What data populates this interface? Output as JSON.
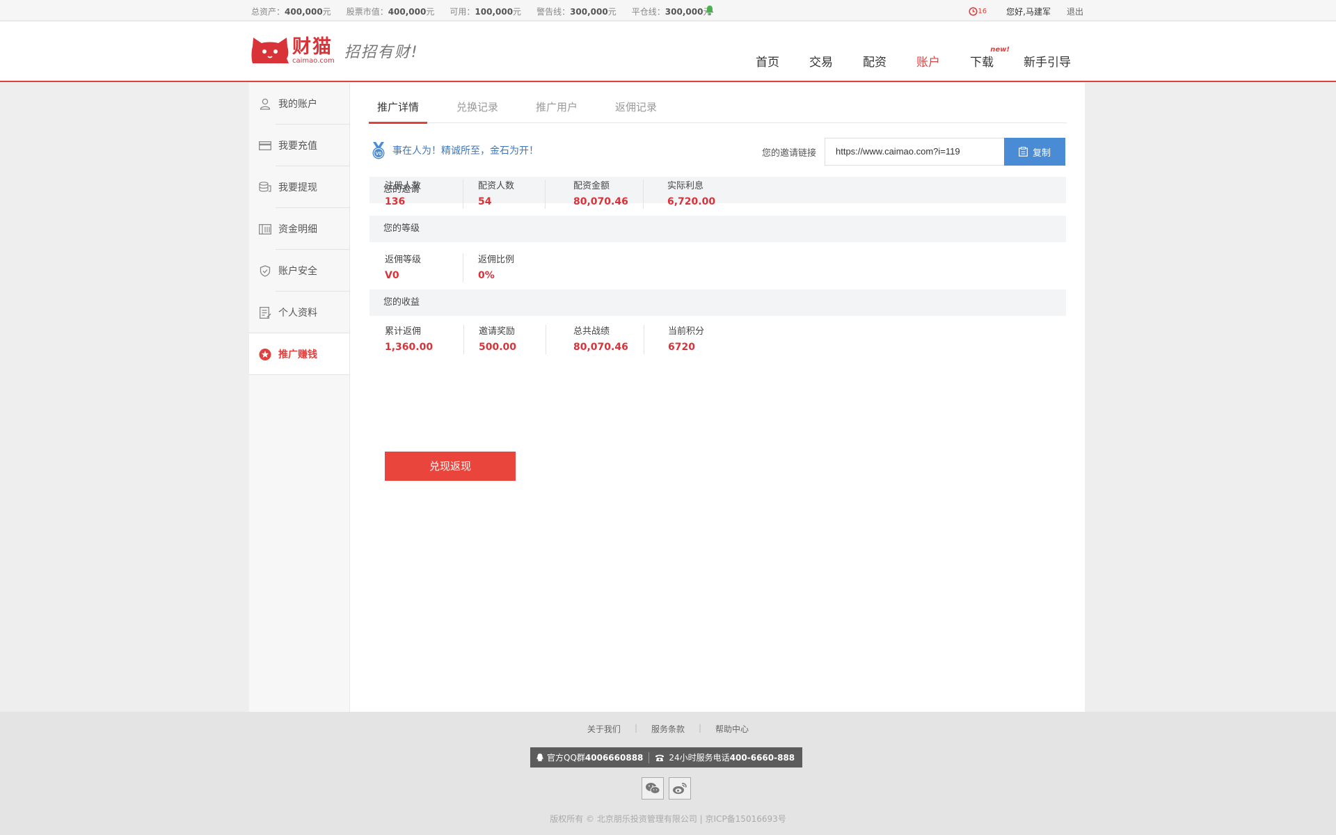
{
  "topbar": {
    "stats": [
      {
        "label": "总资产：",
        "value": "400,000",
        "unit": "元"
      },
      {
        "label": "股票市值：",
        "value": "400,000",
        "unit": "元"
      },
      {
        "label": "可用：",
        "value": "100,000",
        "unit": "元"
      },
      {
        "label": "警告线：",
        "value": "300,000",
        "unit": "元"
      },
      {
        "label": "平仓线：",
        "value": "300,000",
        "unit": "元"
      }
    ],
    "message_count": "16",
    "greeting": "您好,马建军",
    "logout": "退出"
  },
  "header": {
    "brand_name": "财猫",
    "brand_domain": "caimao.com",
    "slogan": "招招有财!",
    "nav": [
      {
        "label": "首页"
      },
      {
        "label": "交易"
      },
      {
        "label": "配资"
      },
      {
        "label": "账户"
      },
      {
        "label": "下载"
      },
      {
        "label": "新手引导"
      }
    ],
    "new_tag": "new!",
    "active_nav": "账户",
    "accent_color": "#e0413e"
  },
  "sidebar": {
    "items": [
      {
        "label": "我的账户",
        "icon": "user-icon"
      },
      {
        "label": "我要充值",
        "icon": "card-icon"
      },
      {
        "label": "我要提现",
        "icon": "coins-icon"
      },
      {
        "label": "资金明细",
        "icon": "ledger-icon"
      },
      {
        "label": "账户安全",
        "icon": "shield-icon"
      },
      {
        "label": "个人资料",
        "icon": "profile-icon"
      },
      {
        "label": "推广赚钱",
        "icon": "star-icon"
      }
    ],
    "active": "推广赚钱"
  },
  "main": {
    "tabs": [
      {
        "label": "推广详情"
      },
      {
        "label": "兑换记录"
      },
      {
        "label": "推广用户"
      },
      {
        "label": "返佣记录"
      }
    ],
    "active_tab": "推广详情",
    "level_badge": "V0",
    "motto": "事在人为！精诚所至，金石为开！",
    "invite_label": "您的邀请链接",
    "invite_url": "https://www.caimao.com?i=119",
    "copy_label": "复制",
    "sections": {
      "invite": {
        "title": "您的邀请",
        "stats": [
          {
            "label": "注册人数",
            "value": "136"
          },
          {
            "label": "配资人数",
            "value": "54"
          },
          {
            "label": "配资金额",
            "value": "80,070.46"
          },
          {
            "label": "实际利息",
            "value": "6,720.00"
          }
        ]
      },
      "level": {
        "title": "您的等级",
        "stats": [
          {
            "label": "返佣等级",
            "value": "V0"
          },
          {
            "label": "返佣比例",
            "value": "0%"
          }
        ]
      },
      "income": {
        "title": "您的收益",
        "stats": [
          {
            "label": "累计返佣",
            "value": "1,360.00"
          },
          {
            "label": "邀请奖励",
            "value": "500.00"
          },
          {
            "label": "总共战绩",
            "value": "80,070.46"
          },
          {
            "label": "当前积分",
            "value": "6720"
          }
        ]
      }
    },
    "cashout_label": "兑现返现"
  },
  "footer": {
    "links": [
      "关于我们",
      "服务条款",
      "帮助中心"
    ],
    "qq_label": "官方QQ群",
    "qq_value": "4006660888",
    "phone_label": "24小时服务电话",
    "phone_value": "400-6660-888",
    "socials": [
      "wechat-icon",
      "weibo-icon"
    ],
    "copyright": "版权所有 © 北京朋乐投资管理有限公司  |  京ICP备15016693号"
  }
}
